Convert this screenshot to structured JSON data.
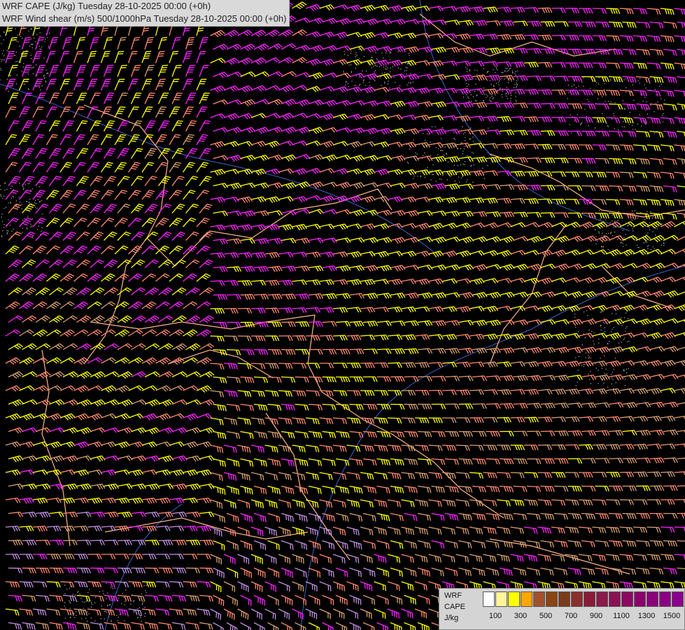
{
  "header": {
    "line1": "WRF CAPE (J/kg) Tuesday 28-10-2025 00:00 (+0h)",
    "line2": "WRF Wind shear (m/s) 500/1000hPa Tuesday 28-10-2025 00:00 (+0h)"
  },
  "legend": {
    "model": "WRF",
    "variable": "CAPE",
    "unit": "J/kg",
    "ticks": [
      "100",
      "300",
      "500",
      "700",
      "900",
      "1100",
      "1300",
      "1500"
    ],
    "colors": [
      "#ffffff",
      "#fff59a",
      "#ffff00",
      "#ffa500",
      "#a0522d",
      "#8b4513",
      "#7a3b1a",
      "#8b2e2e",
      "#8b1a3a",
      "#8b1a4a",
      "#8b1055",
      "#8b0a60",
      "#8b006b",
      "#8b007a",
      "#8b0085",
      "#8b008b"
    ]
  },
  "map": {
    "barb_colors": {
      "magenta": "#ff22ff",
      "yellow": "#ffff00",
      "salmon": "#ff8a6e",
      "tan": "#d9a070",
      "lavender": "#c090e0"
    },
    "border_color": "#ffb38a",
    "river_color": "#3c64c8",
    "coast_color": "#ffffff",
    "topo_color": "#b8b8b8"
  }
}
